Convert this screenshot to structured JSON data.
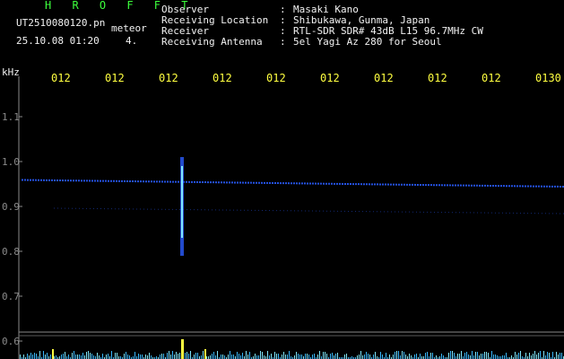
{
  "header": {
    "brand": "H R O F F T",
    "filename": "UT2510080120.pn",
    "classification": "meteor",
    "datetime": "25.10.08 01:20",
    "count": "4.",
    "info": [
      {
        "label": "Observer",
        "value": "Masaki Kano"
      },
      {
        "label": "Receiving Location",
        "value": "Shibukawa, Gunma, Japan"
      },
      {
        "label": "Receiver",
        "value": "RTL-SDR SDR# 43dB L15 96.7MHz CW"
      },
      {
        "label": "Receiving Antenna",
        "value": "5el Yagi Az 280 for Seoul"
      }
    ],
    "separator": ":"
  },
  "chart_data": {
    "type": "heatmap",
    "ylabel": "kHz",
    "y_ticks": [
      "1.1",
      "1.0",
      "0.9",
      "0.8",
      "0.7",
      "0.6"
    ],
    "x_ticks": [
      "012",
      "012",
      "012",
      "012",
      "012",
      "012",
      "012",
      "012",
      "012",
      "0130"
    ],
    "carrier_khz": 0.96,
    "meteor_echo": {
      "x_tick_index": 2,
      "freq_top_khz": 1.01,
      "freq_bottom_khz": 0.79
    }
  },
  "colors": {
    "background": "#000000",
    "label_green": "#3cff3c",
    "tick_yellow": "#ffff40",
    "signal_blue": "#2a5cff",
    "signal_cyan": "#7fe6ff",
    "axis_gray": "#8a8a8a"
  }
}
